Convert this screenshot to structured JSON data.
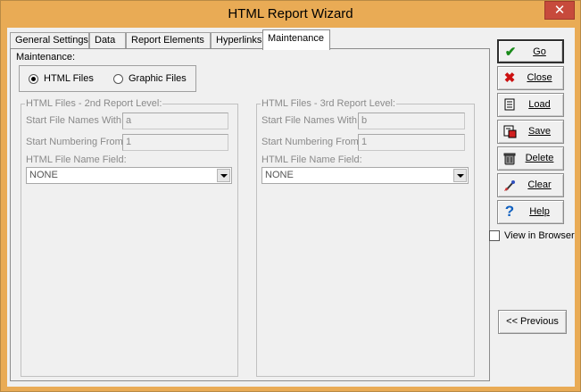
{
  "window": {
    "title": "HTML Report Wizard",
    "close_glyph": "✕"
  },
  "tabs": [
    {
      "label": "General Settings",
      "active": false
    },
    {
      "label": "Data",
      "active": false
    },
    {
      "label": "Report Elements",
      "active": false
    },
    {
      "label": "Hyperlinks",
      "active": false
    },
    {
      "label": "Maintenance",
      "active": true
    }
  ],
  "maintenance": {
    "label": "Maintenance:",
    "radio_html": "HTML Files",
    "radio_graphic": "Graphic Files",
    "selected": "HTML Files"
  },
  "level2": {
    "title": "HTML Files - 2nd Report Level:",
    "start_names_label": "Start File Names With:",
    "start_names_value": "a",
    "start_numbering_label": "Start Numbering From:",
    "start_numbering_value": "1",
    "name_field_label": "HTML File Name Field:",
    "name_field_value": "NONE"
  },
  "level3": {
    "title": "HTML Files - 3rd Report Level:",
    "start_names_label": "Start File Names With:",
    "start_names_value": "b",
    "start_numbering_label": "Start Numbering From:",
    "start_numbering_value": "1",
    "name_field_label": "HTML File Name Field:",
    "name_field_value": "NONE"
  },
  "buttons": {
    "go": "Go",
    "close": "Close",
    "load": "Load",
    "save": "Save",
    "delete": "Delete",
    "clear": "Clear",
    "help": "Help",
    "previous": "<< Previous"
  },
  "icons": {
    "go": "checkmark-icon",
    "close": "red-x-icon",
    "load": "document-icon",
    "save": "save-icon",
    "delete": "trash-icon",
    "clear": "brush-icon",
    "help": "question-icon"
  },
  "view_in_browser": {
    "label": "View in Browser",
    "checked": false
  },
  "colors": {
    "title_bar": "#e9ab55",
    "close_button": "#c74a3c",
    "go_icon": "#1a8a1a",
    "close_icon": "#cc1111",
    "help_icon": "#1060c0"
  }
}
